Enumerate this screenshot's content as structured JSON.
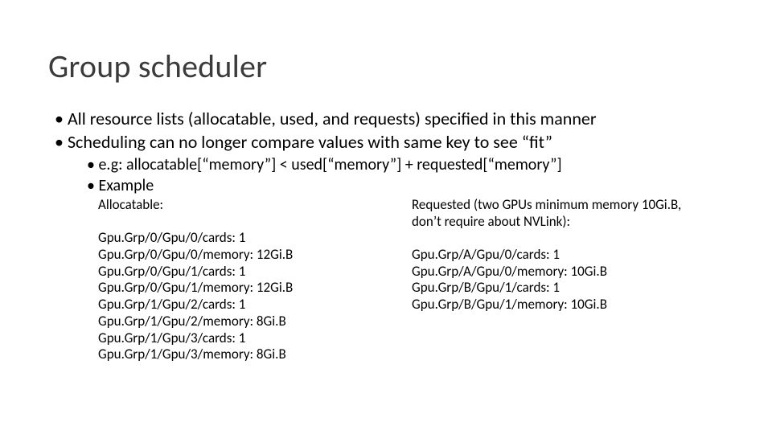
{
  "title": "Group scheduler",
  "bullets": {
    "b1": "All resource lists (allocatable, used, and requests) specified in this manner",
    "b2": "Scheduling can no longer compare values with same key to see “fit”",
    "b2a": "e.g: allocatable[“memory”] < used[“memory”] + requested[“memory”]",
    "b2b": "Example"
  },
  "left": {
    "head": "Allocatable:",
    "lines": [
      "Gpu.Grp/0/Gpu/0/cards: 1",
      "Gpu.Grp/0/Gpu/0/memory: 12Gi.B",
      "Gpu.Grp/0/Gpu/1/cards: 1",
      "Gpu.Grp/0/Gpu/1/memory: 12Gi.B",
      "Gpu.Grp/1/Gpu/2/cards: 1",
      "Gpu.Grp/1/Gpu/2/memory: 8Gi.B",
      "Gpu.Grp/1/Gpu/3/cards: 1",
      "Gpu.Grp/1/Gpu/3/memory: 8Gi.B"
    ]
  },
  "right": {
    "head": "Requested (two GPUs minimum memory 10Gi.B, don’t require about NVLink):",
    "lines": [
      "Gpu.Grp/A/Gpu/0/cards: 1",
      "Gpu.Grp/A/Gpu/0/memory: 10Gi.B",
      "Gpu.Grp/B/Gpu/1/cards: 1",
      "Gpu.Grp/B/Gpu/1/memory: 10Gi.B"
    ]
  }
}
